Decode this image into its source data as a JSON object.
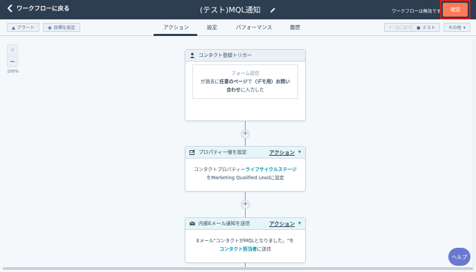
{
  "topbar": {
    "back_label": "ワークフローに戻る",
    "title": "(テスト)MQL通知",
    "status": "ワークフローは無効です",
    "review_label": "確認"
  },
  "subbar": {
    "alert_label": "アラート",
    "goal_label": "目標を設定",
    "tabs": [
      {
        "label": "アクション",
        "active": true
      },
      {
        "label": "設定",
        "active": false
      },
      {
        "label": "パフォーマンス",
        "active": false
      },
      {
        "label": "履歴",
        "active": false
      }
    ],
    "undo_label": "元に戻す",
    "test_label": "テスト",
    "more_label": "その他"
  },
  "canvas": {
    "zoom_in": "+",
    "zoom_out": "−",
    "zoom_level": "100%",
    "trigger": {
      "header": "コンタクト登録トリガー",
      "form_title": "フォーム送信",
      "text_1": "が過去に",
      "text_2": "任意のページ",
      "text_3": "で",
      "text_4": "（デモ用）お問い合わせ",
      "text_5": "に入力した"
    },
    "action1": {
      "header": "プロパティー値を設定",
      "menu": "アクション",
      "text_1": "コンタクトプロパティー",
      "text_2": "ライフサイクルステージ",
      "text_3": "をMarketing Qualified Leadに設定"
    },
    "action2": {
      "header": "内部Eメール通知を送信",
      "menu": "アクション",
      "text_1": "Eメール\"コンタクトがMQLとなりました。\"を",
      "text_2": "コンタクト担当者",
      "text_3": "に送信"
    },
    "plus": "+"
  },
  "help_label": "ヘルプ",
  "colors": {
    "topbar": "#2d3e50",
    "accent": "#ff7a59",
    "highlight": "#d11f1f",
    "link": "#0091ae",
    "help": "#6a78d1"
  }
}
